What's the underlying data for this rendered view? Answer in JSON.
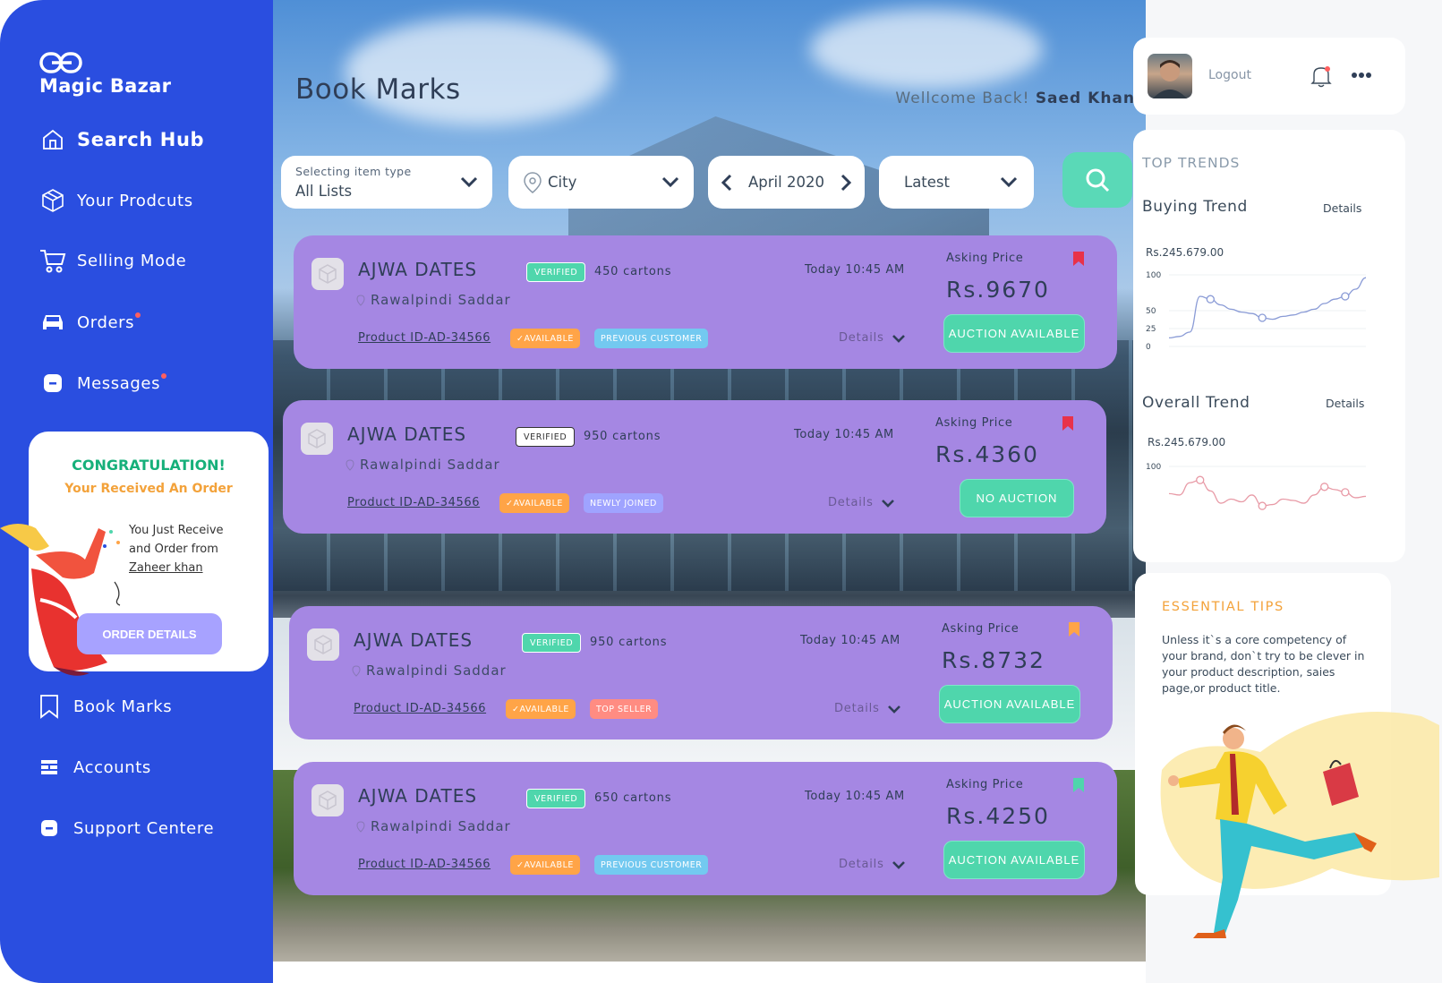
{
  "brand": {
    "name": "Magic Bazar",
    "accent": "#2a4ee0"
  },
  "sidebar": {
    "items": [
      {
        "label": "Search Hub",
        "icon": "home-icon",
        "active": true
      },
      {
        "label": "Your Prodcuts",
        "icon": "box-icon"
      },
      {
        "label": "Selling Mode",
        "icon": "cart-icon"
      },
      {
        "label": "Orders",
        "icon": "car-icon",
        "badge": true
      },
      {
        "label": "Messages",
        "icon": "message-icon",
        "badge": true
      },
      {
        "label": "Book Marks",
        "icon": "bookmark-icon"
      },
      {
        "label": "Accounts",
        "icon": "accounts-icon"
      },
      {
        "label": "Support Centere",
        "icon": "support-icon"
      }
    ]
  },
  "congrats": {
    "title": "CONGRATULATION!",
    "subtitle": "Your Received An Order",
    "line1": "You Just Receive",
    "line2": "and Order from",
    "customer": "Zaheer khan",
    "button": "ORDER DETAILS"
  },
  "header": {
    "title": "Book Marks",
    "welcome": "Wellcome Back!",
    "user": "Saed Khan"
  },
  "filters": {
    "type_label": "Selecting item type",
    "type_value": "All Lists",
    "city": "City",
    "month": "April 2020",
    "sort": "Latest"
  },
  "cards": [
    {
      "name": "AJWA DATES",
      "location": "Rawalpindi Saddar",
      "verified": "VERIFIED",
      "cartons": "450 cartons",
      "time": "Today 10:45 AM",
      "product_id": "Product ID-AD-34566",
      "tag1": "AVAILABLE",
      "tag2": "PREVIOUS CUSTOMER",
      "details": "Details",
      "asking": "Asking Price",
      "price": "Rs.9670",
      "auction": "AUCTION AVAILABLE",
      "bookmark_color": "#e8324a"
    },
    {
      "name": "AJWA DATES",
      "location": "Rawalpindi Saddar",
      "verified": "VERIFIED",
      "cartons": "950 cartons",
      "time": "Today 10:45 AM",
      "product_id": "Product ID-AD-34566",
      "tag1": "AVAILABLE",
      "tag2": "NEWLY JOINED",
      "details": "Details",
      "asking": "Asking Price",
      "price": "Rs.4360",
      "auction": "NO AUCTION",
      "bookmark_color": "#e8324a"
    },
    {
      "name": "AJWA DATES",
      "location": "Rawalpindi Saddar",
      "verified": "VERIFIED",
      "cartons": "950 cartons",
      "time": "Today 10:45 AM",
      "product_id": "Product ID-AD-34566",
      "tag1": "AVAILABLE",
      "tag2": "TOP SELLER",
      "details": "Details",
      "asking": "Asking Price",
      "price": "Rs.8732",
      "auction": "AUCTION AVAILABLE",
      "bookmark_color": "#ffa447"
    },
    {
      "name": "AJWA DATES",
      "location": "Rawalpindi Saddar",
      "verified": "VERIFIED",
      "cartons": "650 cartons",
      "time": "Today 10:45 AM",
      "product_id": "Product ID-AD-34566",
      "tag1": "AVAILABLE",
      "tag2": "PREVIOUS CUSTOMER",
      "details": "Details",
      "asking": "Asking Price",
      "price": "Rs.4250",
      "auction": "AUCTION AVAILABLE",
      "bookmark_color": "#4fd6ac"
    }
  ],
  "user_panel": {
    "logout": "Logout"
  },
  "trends": {
    "title": "TOP TRENDS",
    "buying": {
      "label": "Buying Trend",
      "details": "Details",
      "value": "Rs.245.679.00",
      "ticks": [
        "100",
        "50",
        "25",
        "0"
      ]
    },
    "overall": {
      "label": "Overall Trend",
      "details": "Details",
      "value": "Rs.245.679.00",
      "ticks": [
        "100"
      ]
    }
  },
  "chart_data": [
    {
      "type": "line",
      "title": "Buying Trend",
      "yticks": [
        100,
        50,
        25,
        0
      ],
      "values": [
        12,
        14,
        20,
        70,
        66,
        58,
        52,
        48,
        46,
        40,
        38,
        42,
        44,
        48,
        52,
        60,
        66,
        70,
        80,
        96
      ]
    },
    {
      "type": "line",
      "title": "Overall Trend",
      "yticks": [
        100
      ],
      "values": [
        60,
        58,
        76,
        80,
        64,
        46,
        52,
        48,
        58,
        42,
        44,
        52,
        50,
        46,
        58,
        70,
        66,
        62,
        54,
        56
      ]
    }
  ],
  "tips": {
    "title": "ESSENTIAL TIPS",
    "text": "Unless it`s a core competency of your brand, don`t try to be clever in your product description, saies page,or product title."
  }
}
